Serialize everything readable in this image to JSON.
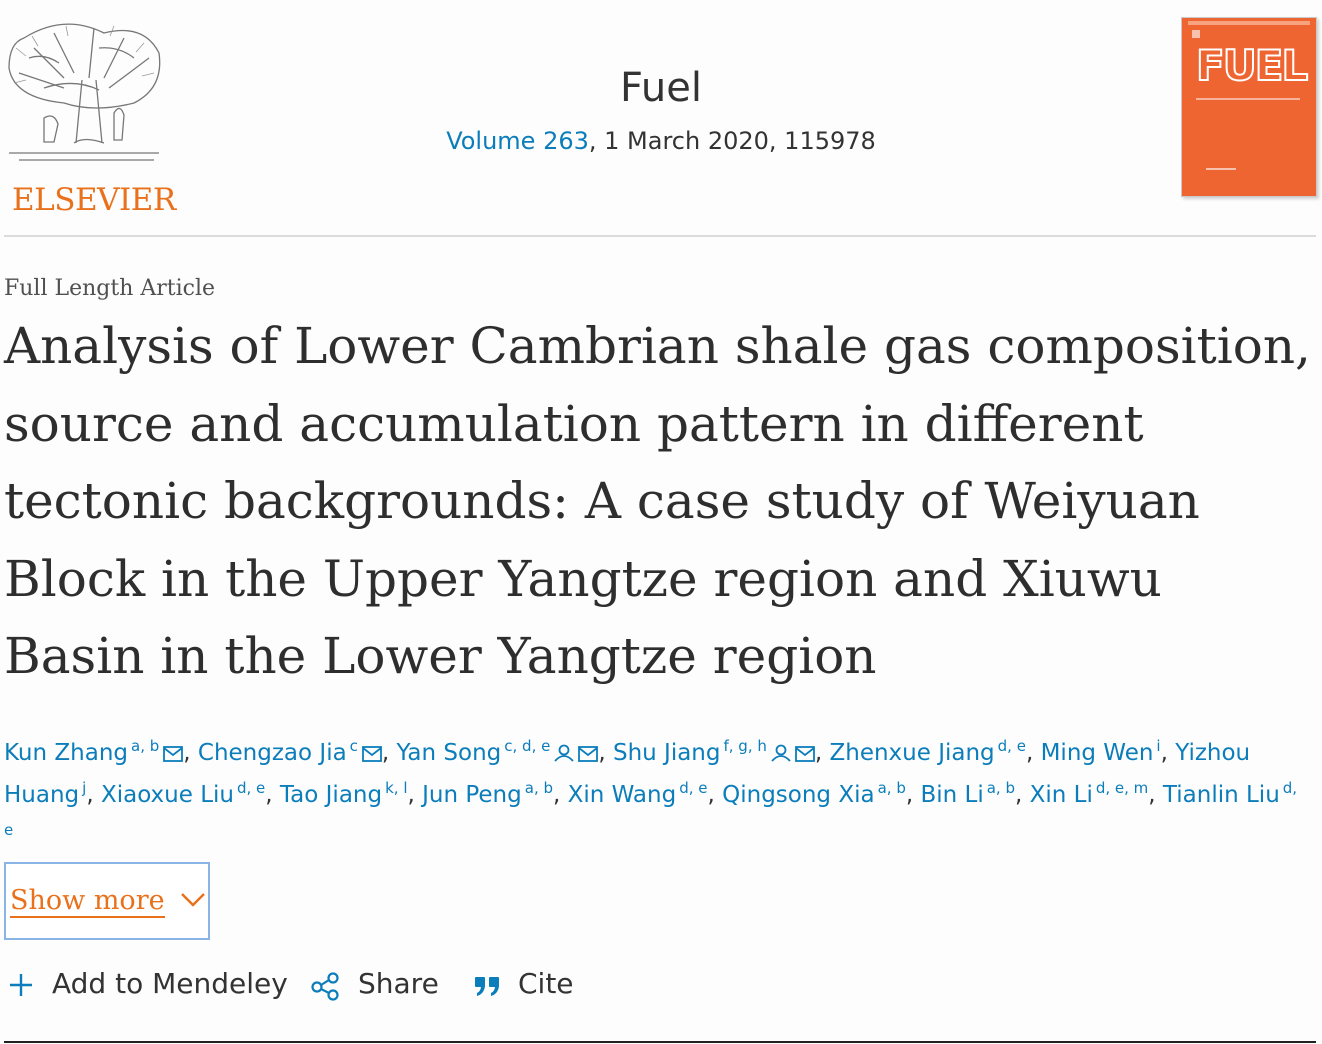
{
  "publisher": {
    "logo_name": "ELSEVIER"
  },
  "journal": {
    "title": "Fuel",
    "volume_link": "Volume 263",
    "issue_info": ", 1 March 2020, 115978",
    "cover_title": "FUEL"
  },
  "article": {
    "type": "Full Length Article",
    "title": "Analysis of Lower Cambrian shale gas composition, source and accumulation pattern in different tectonic backgrounds: A case study of Weiyuan Block in the Upper Yangtze region and Xiuwu Basin in the Lower Yangtze region"
  },
  "authors": [
    {
      "name": "Kun Zhang",
      "sup": "a, b",
      "email": true,
      "person": false
    },
    {
      "name": "Chengzao Jia",
      "sup": "c",
      "email": true,
      "person": false
    },
    {
      "name": "Yan Song",
      "sup": "c, d, e",
      "email": true,
      "person": true
    },
    {
      "name": "Shu Jiang",
      "sup": "f, g, h",
      "email": true,
      "person": true
    },
    {
      "name": "Zhenxue Jiang",
      "sup": "d, e",
      "email": false,
      "person": false
    },
    {
      "name": "Ming Wen",
      "sup": "i",
      "email": false,
      "person": false
    },
    {
      "name": "Yizhou Huang",
      "sup": "j",
      "email": false,
      "person": false
    },
    {
      "name": "Xiaoxue Liu",
      "sup": "d, e",
      "email": false,
      "person": false
    },
    {
      "name": "Tao Jiang",
      "sup": "k, l",
      "email": false,
      "person": false
    },
    {
      "name": "Jun Peng",
      "sup": "a, b",
      "email": false,
      "person": false
    },
    {
      "name": "Xin Wang",
      "sup": "d, e",
      "email": false,
      "person": false
    },
    {
      "name": "Qingsong Xia",
      "sup": "a, b",
      "email": false,
      "person": false
    },
    {
      "name": "Bin Li",
      "sup": "a, b",
      "email": false,
      "person": false
    },
    {
      "name": "Xin Li",
      "sup": "d, e, m",
      "email": false,
      "person": false
    },
    {
      "name": "Tianlin Liu",
      "sup": "d, e",
      "email": false,
      "person": false
    }
  ],
  "show_more": {
    "label": "Show more",
    "icon": "chevron-down-icon"
  },
  "actions": {
    "mendeley": {
      "label": "Add to Mendeley",
      "icon": "plus-icon"
    },
    "share": {
      "label": "Share",
      "icon": "share-icon"
    },
    "cite": {
      "label": "Cite",
      "icon": "quote-icon"
    }
  },
  "colors": {
    "link": "#0c7dbb",
    "accent": "#e9711c",
    "cover": "#ee6532"
  }
}
